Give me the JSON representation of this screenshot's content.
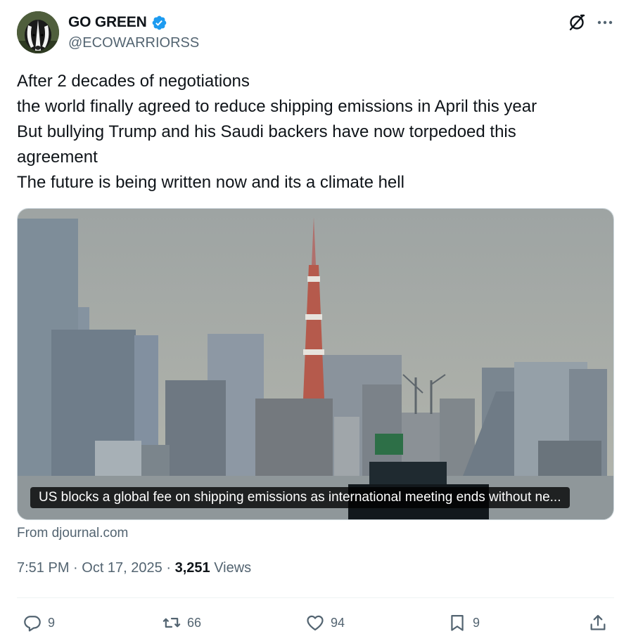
{
  "author": {
    "display_name": "GO GREEN",
    "handle": "@ECOWARRIORSS",
    "verified": true,
    "avatar_icon": "badger-avatar"
  },
  "tweet": {
    "lines": [
      "After 2 decades of negotiations",
      "the world finally agreed to reduce shipping emissions in April this year",
      "But bullying Trump and his Saudi backers have now torpedoed this",
      "agreement",
      "The future is being written now and its a climate hell"
    ]
  },
  "card": {
    "caption": "US blocks a global fee on shipping emissions as international meeting ends without ne...",
    "source": "From djournal.com"
  },
  "meta": {
    "time": "7:51 PM",
    "separator": " · ",
    "date": "Oct 17, 2025",
    "views_count": "3,251",
    "views_label": " Views"
  },
  "actions": {
    "replies": "9",
    "reposts": "66",
    "likes": "94",
    "bookmarks": "9"
  },
  "colors": {
    "text": "#0f1419",
    "secondary": "#536471",
    "verified": "#1d9bf0",
    "divider": "#eff3f4"
  }
}
